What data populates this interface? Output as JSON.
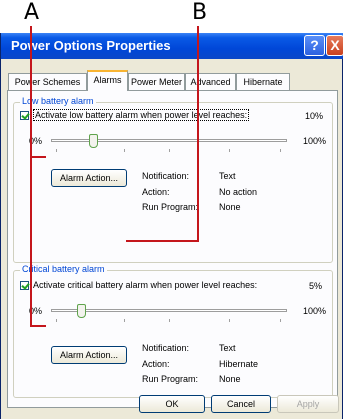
{
  "callouts": {
    "a": "A",
    "b": "B"
  },
  "window": {
    "title": "Power Options Properties",
    "help_label": "?",
    "close_label": "X"
  },
  "tabs": [
    "Power Schemes",
    "Alarms",
    "Power Meter",
    "Advanced",
    "Hibernate"
  ],
  "low": {
    "group_label": "Low battery alarm",
    "checkbox_label": "Activate low battery alarm when power level reaches:",
    "checked": true,
    "percent": "10%",
    "min": "0%",
    "max": "100%",
    "level": 0.1,
    "alarm_button": "Alarm Action...",
    "notification_label": "Notification:",
    "notification_value": "Text",
    "action_label": "Action:",
    "action_value": "No action",
    "run_label": "Run Program:",
    "run_value": "None"
  },
  "critical": {
    "group_label": "Critical battery alarm",
    "checkbox_label": "Activate critical battery alarm when power level reaches:",
    "checked": true,
    "percent": "5%",
    "min": "0%",
    "max": "100%",
    "level": 0.05,
    "alarm_button": "Alarm Action...",
    "notification_label": "Notification:",
    "notification_value": "Text",
    "action_label": "Action:",
    "action_value": "Hibernate",
    "run_label": "Run Program:",
    "run_value": "None"
  },
  "footer": {
    "ok": "OK",
    "cancel": "Cancel",
    "apply": "Apply"
  },
  "colors": {
    "annotation": "#c4161c",
    "title_bar": "#0a5ae6",
    "group_label": "#0046d5"
  }
}
